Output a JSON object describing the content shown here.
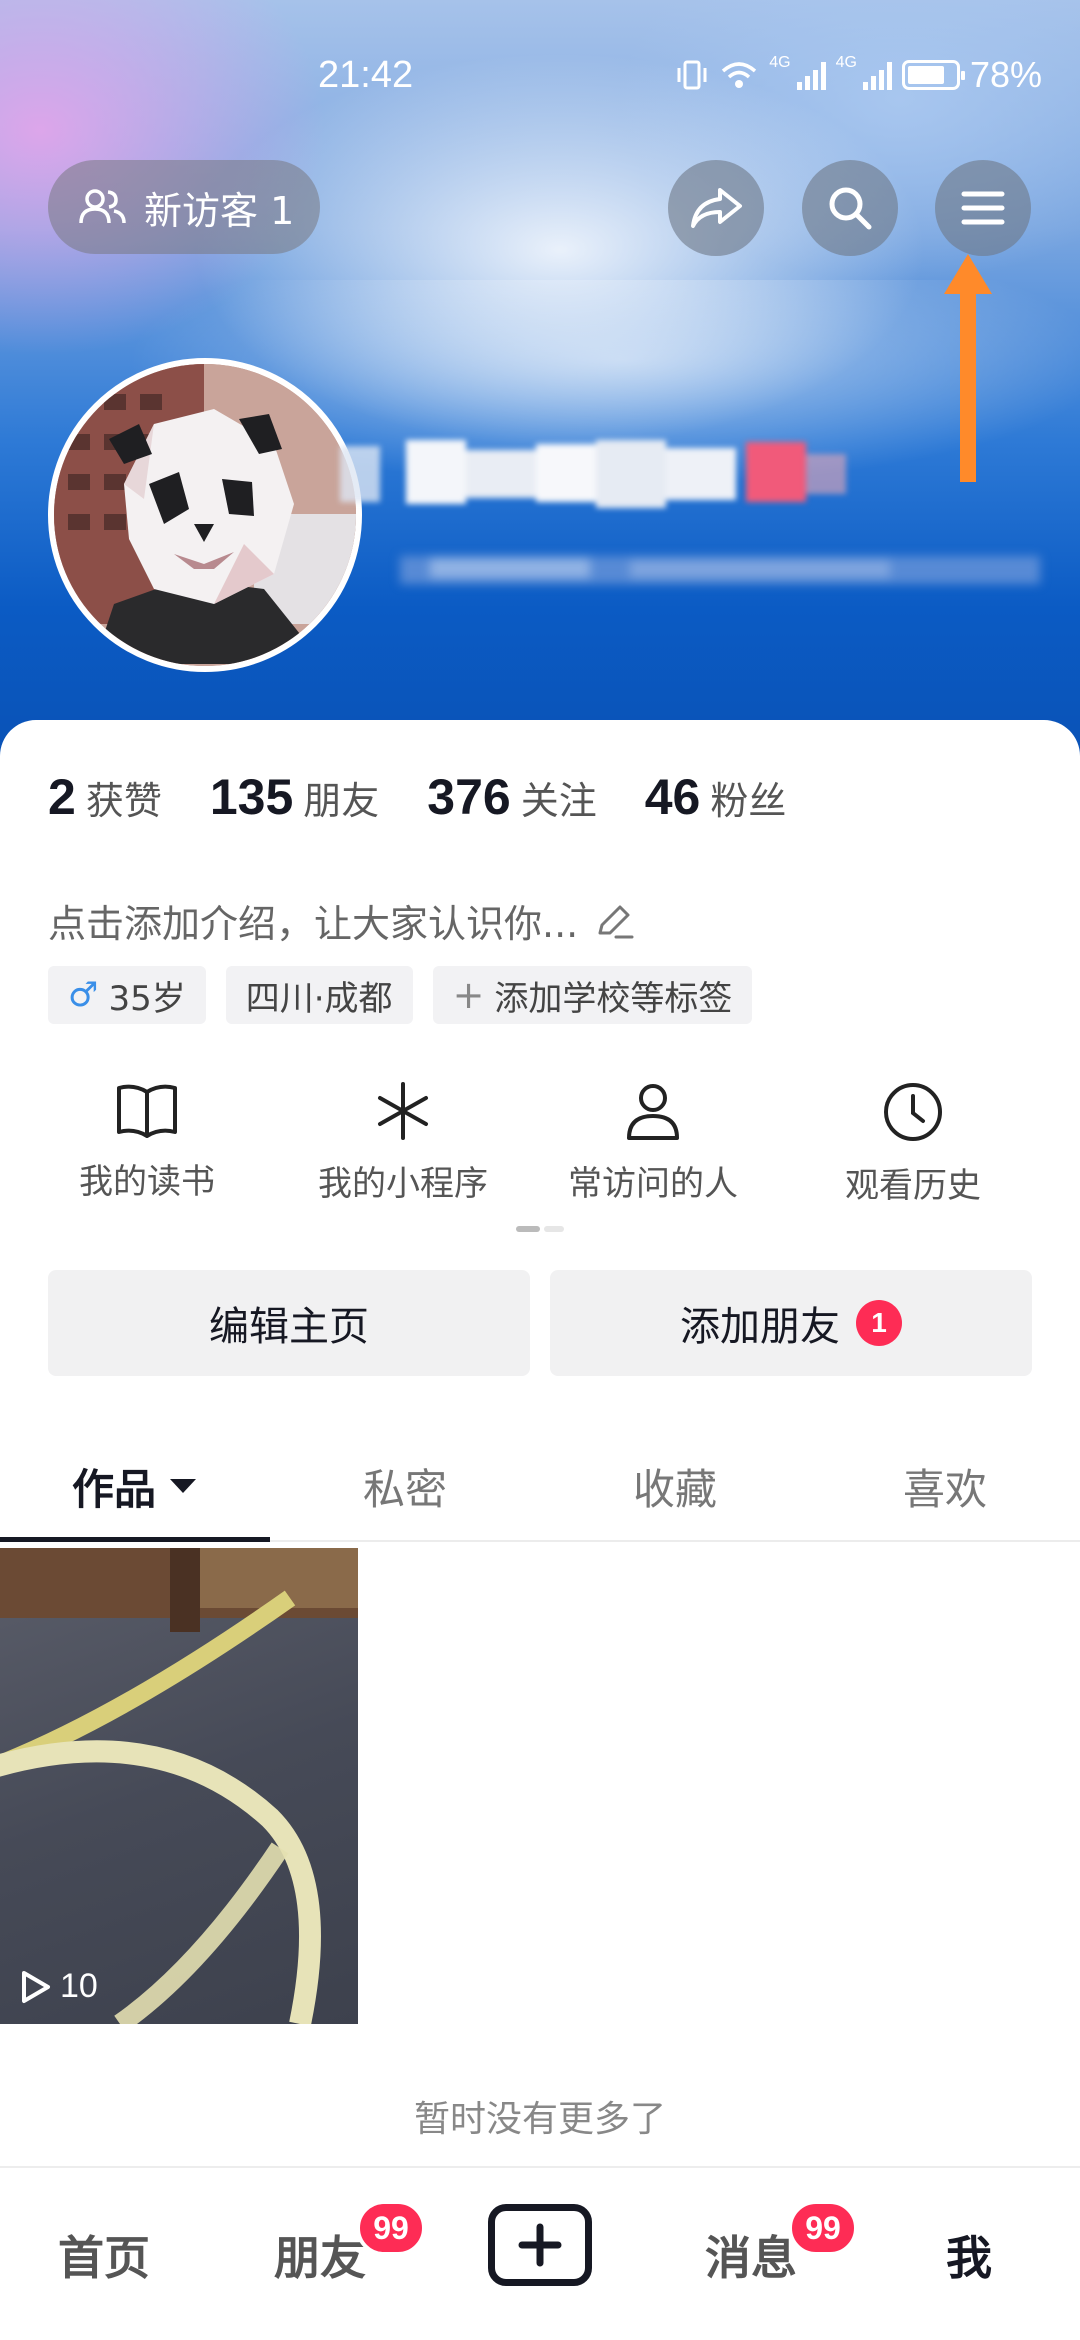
{
  "status_bar": {
    "time": "21:42",
    "network_1": "4G",
    "network_2": "4G",
    "battery_percent": "78%",
    "battery_level": 0.78
  },
  "header": {
    "visitor_label": "新访客 1",
    "share_icon": "share-icon",
    "search_icon": "search-icon",
    "menu_icon": "menu-icon",
    "arrow_color": "#ff8a2a"
  },
  "stats": [
    {
      "value": "2",
      "label": "获赞"
    },
    {
      "value": "135",
      "label": "朋友"
    },
    {
      "value": "376",
      "label": "关注"
    },
    {
      "value": "46",
      "label": "粉丝"
    }
  ],
  "profile": {
    "intro": "点击添加介绍，让大家认识你...",
    "tags": [
      {
        "icon": "♂",
        "text": "35岁"
      },
      {
        "text": "四川·成都"
      },
      {
        "icon": "+",
        "text": "添加学校等标签"
      }
    ]
  },
  "shortcuts": [
    {
      "label": "我的读书",
      "icon": "book-icon"
    },
    {
      "label": "我的小程序",
      "icon": "mini-program-icon"
    },
    {
      "label": "常访问的人",
      "icon": "person-icon"
    },
    {
      "label": "观看历史",
      "icon": "clock-icon"
    }
  ],
  "actions": {
    "edit_label": "编辑主页",
    "add_friend_label": "添加朋友",
    "add_friend_badge": "1"
  },
  "tabs": [
    {
      "label": "作品",
      "active": true
    },
    {
      "label": "私密"
    },
    {
      "label": "收藏"
    },
    {
      "label": "喜欢"
    }
  ],
  "videos": [
    {
      "play_count": "10"
    }
  ],
  "footer_text": "暂时没有更多了",
  "bottom_nav": {
    "home": "首页",
    "friends": "朋友",
    "friends_badge": "99",
    "messages": "消息",
    "messages_badge": "99",
    "me": "我"
  },
  "colors": {
    "accent_red": "#fe2c55",
    "male_blue": "#3a8fe8"
  }
}
